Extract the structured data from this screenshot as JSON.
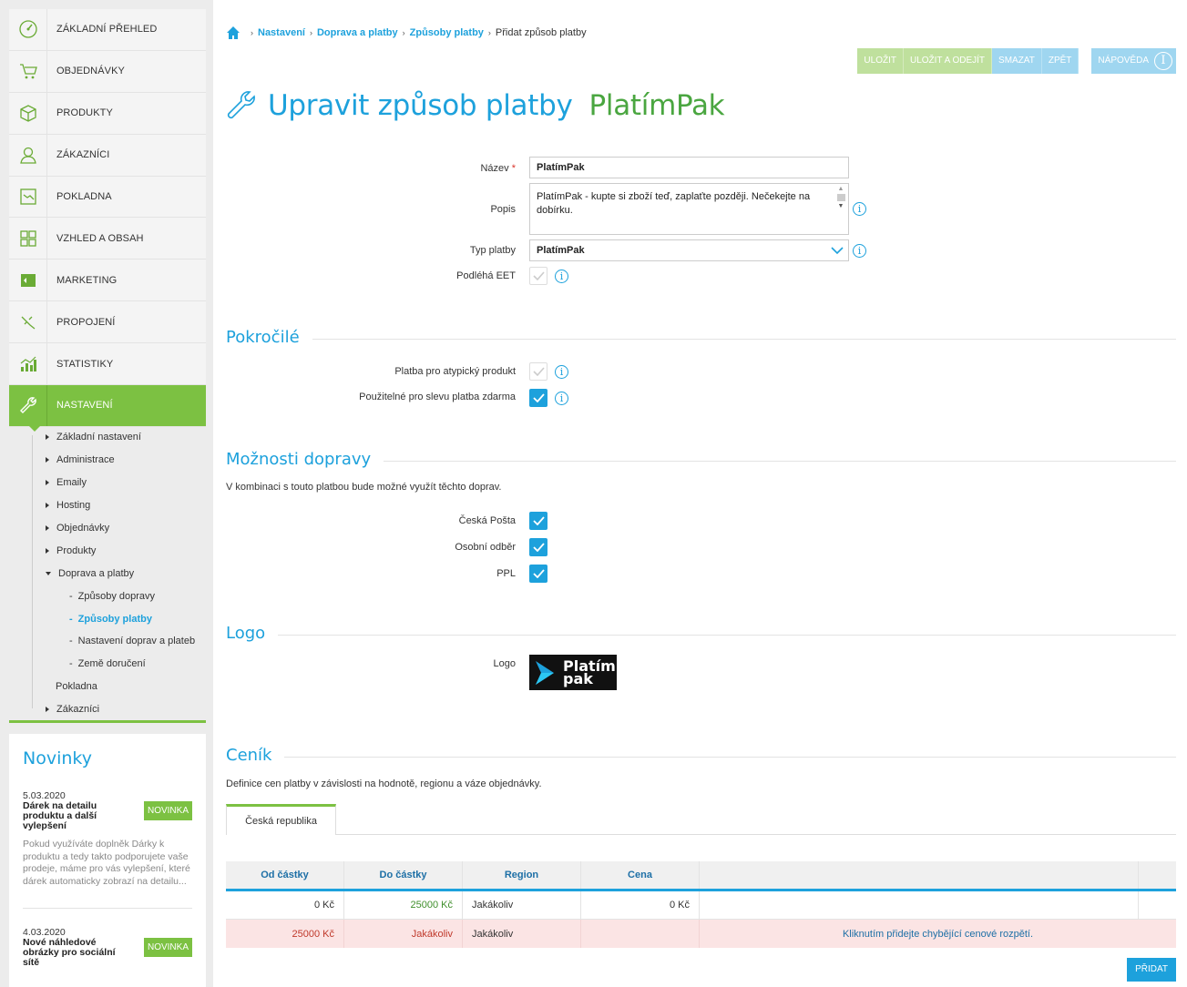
{
  "sidebar": {
    "menu": [
      {
        "label": "ZÁKLADNÍ PŘEHLED",
        "icon": "dashboard-icon"
      },
      {
        "label": "OBJEDNÁVKY",
        "icon": "cart-icon"
      },
      {
        "label": "PRODUKTY",
        "icon": "box-icon"
      },
      {
        "label": "ZÁKAZNÍCI",
        "icon": "user-icon"
      },
      {
        "label": "POKLADNA",
        "icon": "register-icon"
      },
      {
        "label": "VZHLED A OBSAH",
        "icon": "layout-icon"
      },
      {
        "label": "MARKETING",
        "icon": "marketing-icon"
      },
      {
        "label": "PROPOJENÍ",
        "icon": "plug-icon"
      },
      {
        "label": "STATISTIKY",
        "icon": "chart-icon"
      },
      {
        "label": "NASTAVENÍ",
        "icon": "wrench-icon"
      }
    ],
    "submenu": [
      "Základní nastavení",
      "Administrace",
      "Emaily",
      "Hosting",
      "Objednávky",
      "Produkty",
      "Doprava a platby"
    ],
    "submenu_lvl2": [
      "Způsoby dopravy",
      "Způsoby platby",
      "Nastavení doprav a plateb",
      "Země doručení"
    ],
    "submenu_tail": [
      "Pokladna",
      "Zákazníci"
    ],
    "accent": "#7cc142"
  },
  "news": {
    "title": "Novinky",
    "items": [
      {
        "date": "5.03.2020",
        "title": "Dárek na detailu produktu a další vylepšení",
        "badge": "NOVINKA",
        "text": "Pokud využíváte doplněk Dárky k produktu a tedy takto podporujete vaše prodeje, máme pro vás vylepšení, které dárek automaticky zobrazí na detailu..."
      },
      {
        "date": "4.03.2020",
        "title": "Nové náhledové obrázky pro sociální sítě",
        "badge": "NOVINKA"
      }
    ]
  },
  "breadcrumb": {
    "items": [
      "Nastavení",
      "Doprava a platby",
      "Způsoby platby"
    ],
    "current": "Přidat způsob platby"
  },
  "toolbar": {
    "save": "ULOŽIT",
    "save_exit": "ULOŽIT A ODEJÍT",
    "delete": "SMAZAT",
    "back": "ZPĚT",
    "help": "NÁPOVĚDA"
  },
  "page": {
    "title": "Upravit způsob platby",
    "name": "PlatímPak"
  },
  "form": {
    "name_label": "Název",
    "name_value": "PlatímPak",
    "desc_label": "Popis",
    "desc_value": "PlatímPak - kupte si zboží teď, zaplaťte později. Nečekejte na dobírku.",
    "type_label": "Typ platby",
    "type_value": "PlatímPak",
    "eet_label": "Podléhá EET"
  },
  "advanced": {
    "title": "Pokročilé",
    "atypical_label": "Platba pro atypický produkt",
    "free_label": "Použitelné pro slevu platba zdarma"
  },
  "shipping": {
    "title": "Možnosti dopravy",
    "note": "V kombinaci s touto platbou bude možné využít těchto doprav.",
    "options": [
      "Česká Pošta",
      "Osobní odběr",
      "PPL"
    ]
  },
  "logo": {
    "title": "Logo",
    "label": "Logo",
    "text_line1": "Platím",
    "text_line2": "pak"
  },
  "pricing": {
    "title": "Ceník",
    "note": "Definice cen platby v závislosti na hodnotě, regionu a váze objednávky.",
    "tab": "Česká republika",
    "headers": [
      "Od částky",
      "Do částky",
      "Region",
      "Cena"
    ],
    "row": {
      "from": "0 Kč",
      "to": "25000 Kč",
      "region": "Jakákoliv",
      "price": "0 Kč"
    },
    "err_row": {
      "from": "25000 Kč",
      "to": "Jakákoliv",
      "region": "Jakákoliv",
      "message": "Kliknutím přidejte chybějící cenové rozpětí."
    },
    "add": "PŘIDAT"
  },
  "colors": {
    "blue": "#1da1dc",
    "green": "#7cc142",
    "title_green": "#4aa640"
  }
}
